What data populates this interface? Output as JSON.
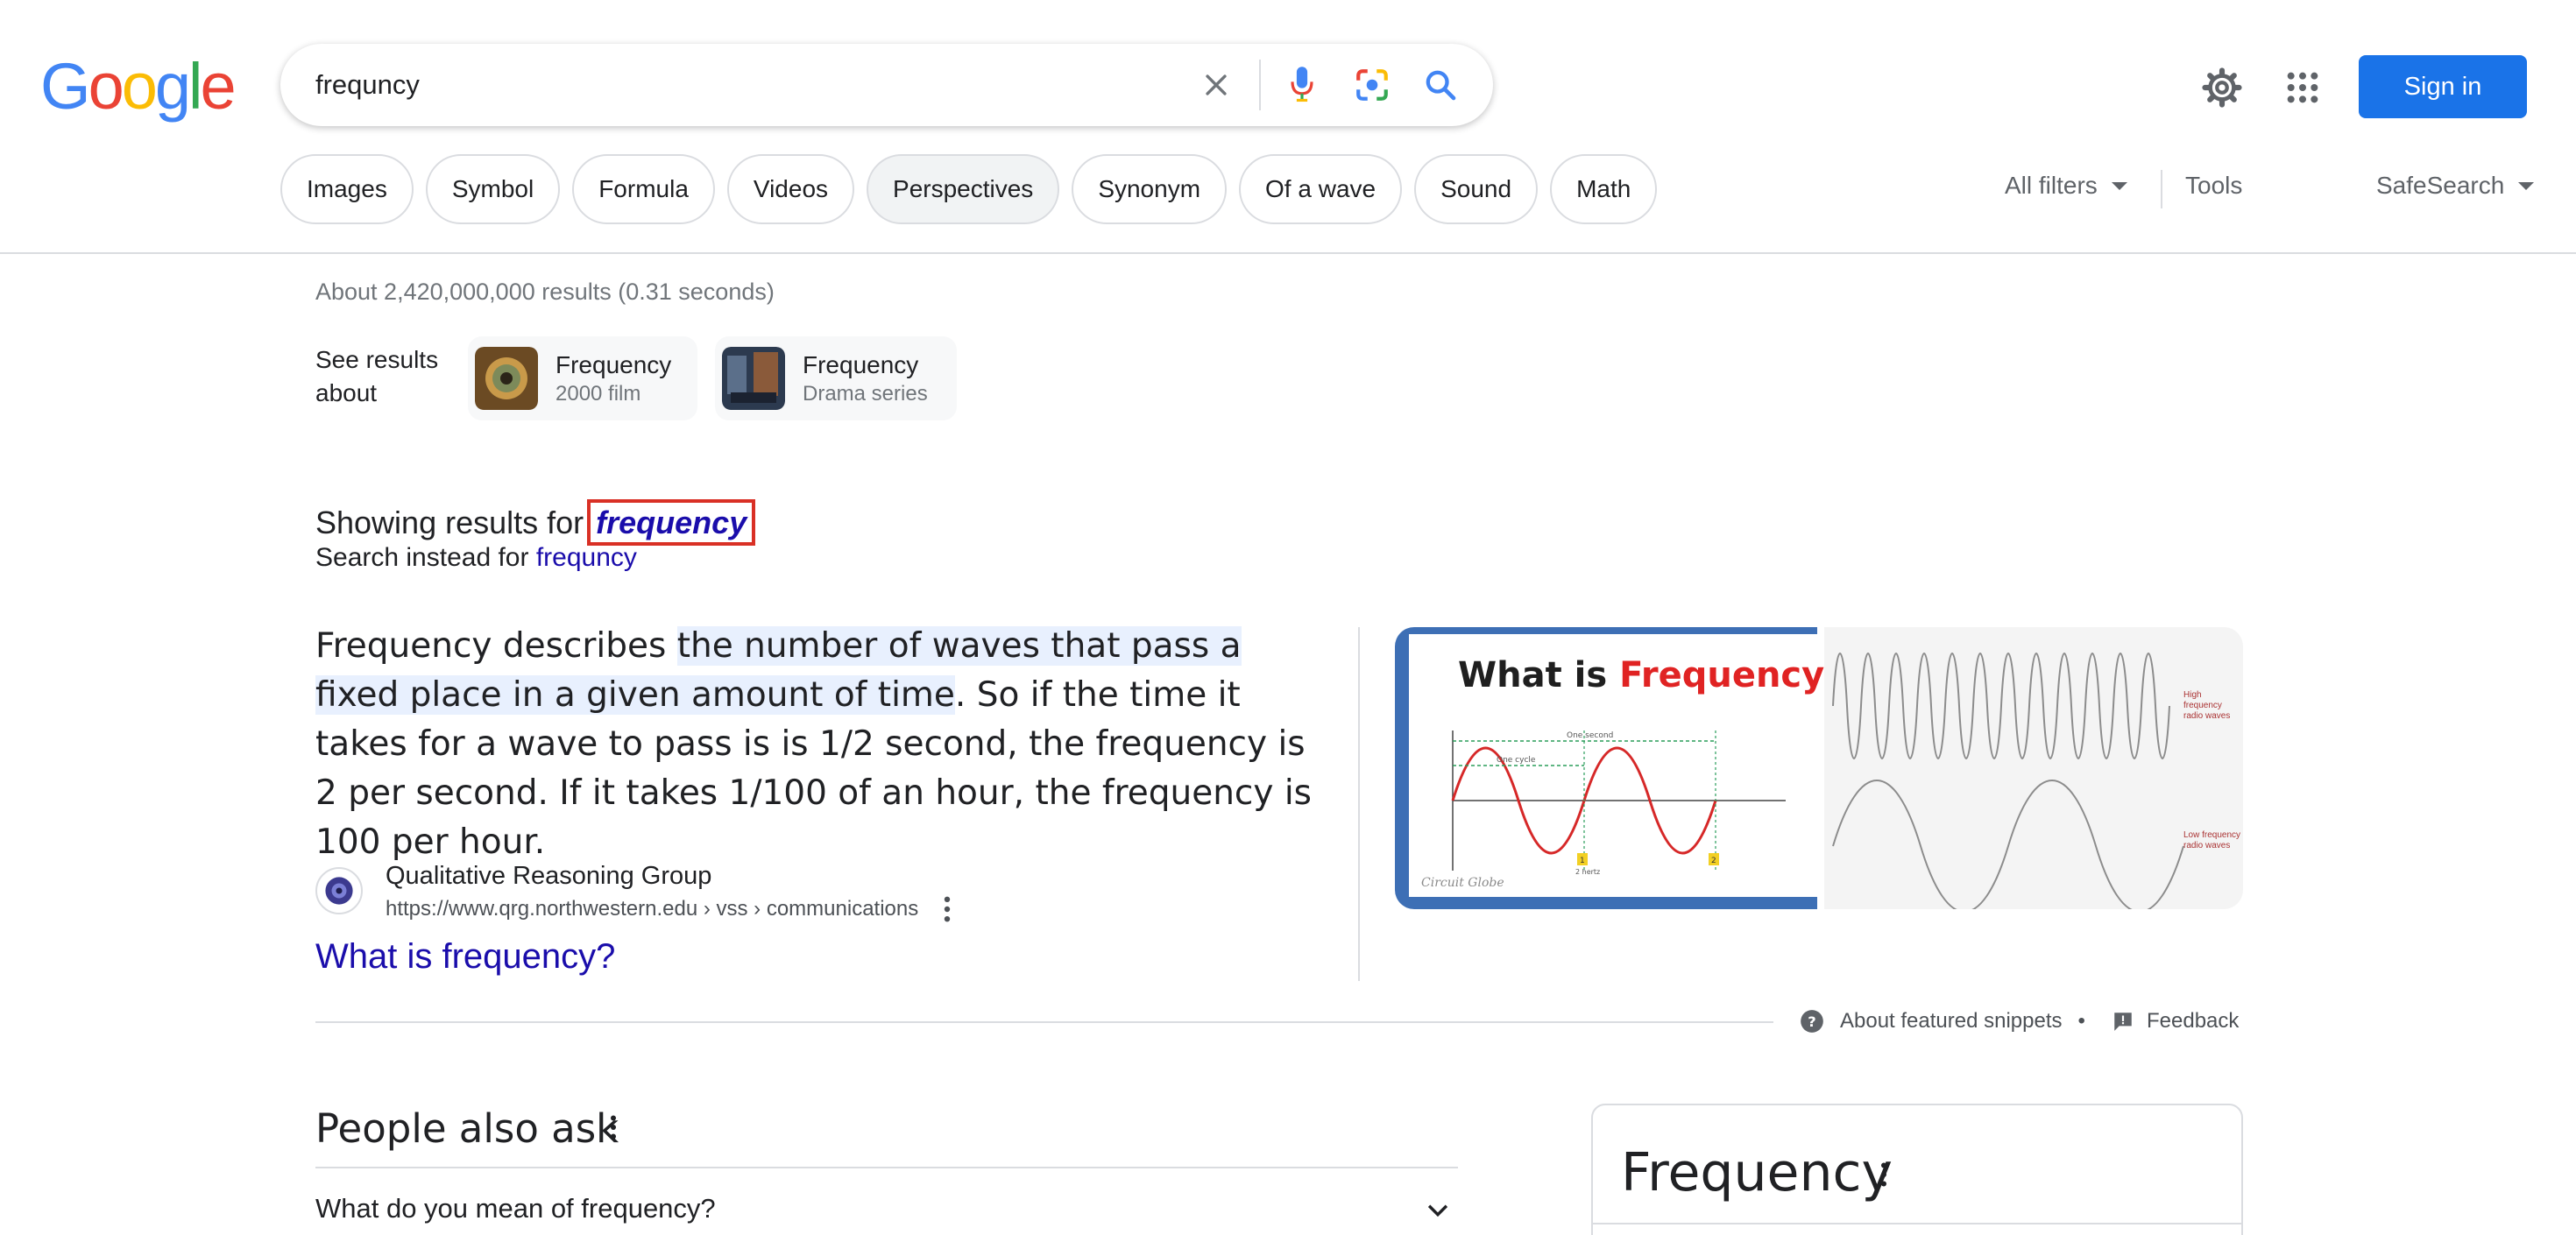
{
  "logo": {
    "letters": [
      "G",
      "o",
      "o",
      "g",
      "l",
      "e"
    ]
  },
  "search": {
    "query": "frequncy"
  },
  "header": {
    "signin_label": "Sign in"
  },
  "chips": [
    "Images",
    "Symbol",
    "Formula",
    "Videos",
    "Perspectives",
    "Synonym",
    "Of a wave",
    "Sound",
    "Math"
  ],
  "chips_active_index": 4,
  "filters": {
    "all_filters": "All filters",
    "tools": "Tools",
    "safesearch": "SafeSearch"
  },
  "stats": "About 2,420,000,000 results (0.31 seconds)",
  "see_results": {
    "label": "See results about",
    "cards": [
      {
        "title": "Frequency",
        "subtitle": "2000 film"
      },
      {
        "title": "Frequency",
        "subtitle": "Drama series"
      }
    ]
  },
  "correction": {
    "showing_prefix": "Showing results for ",
    "corrected": "frequency",
    "instead_prefix": "Search instead for ",
    "instead_link": "frequncy"
  },
  "featured": {
    "text_before": "Frequency describes ",
    "text_highlight": "the number of waves that pass a fixed place in a given amount of time",
    "text_after": ". So if the time it takes for a wave to pass is is 1/2 second, the frequency is 2 per second. If it takes 1/100 of an hour, the frequency is 100 per hour.",
    "source_name": "Qualitative Reasoning Group",
    "source_url": "https://www.qrg.northwestern.edu › vss › communications",
    "link_title": "What is frequency?",
    "image1": {
      "title_prefix": "What is ",
      "title_word": "Frequency",
      "caption": "Circuit Globe",
      "labels": [
        "One second",
        "One cycle",
        "1",
        "2",
        "2 hertz"
      ]
    },
    "image2": {
      "label_high": "High frequency radio waves",
      "label_low": "Low frequency radio waves"
    }
  },
  "footer_links": {
    "about": "About featured snippets",
    "separator": "•",
    "feedback": "Feedback"
  },
  "paa": {
    "title": "People also ask",
    "questions": [
      "What do you mean of frequency?"
    ]
  },
  "knowledge_panel": {
    "title": "Frequency"
  },
  "colors": {
    "link": "#1a0dab",
    "accent": "#1a73e8",
    "highlight": "#e8f0fe",
    "correction_box": "#d93025"
  }
}
